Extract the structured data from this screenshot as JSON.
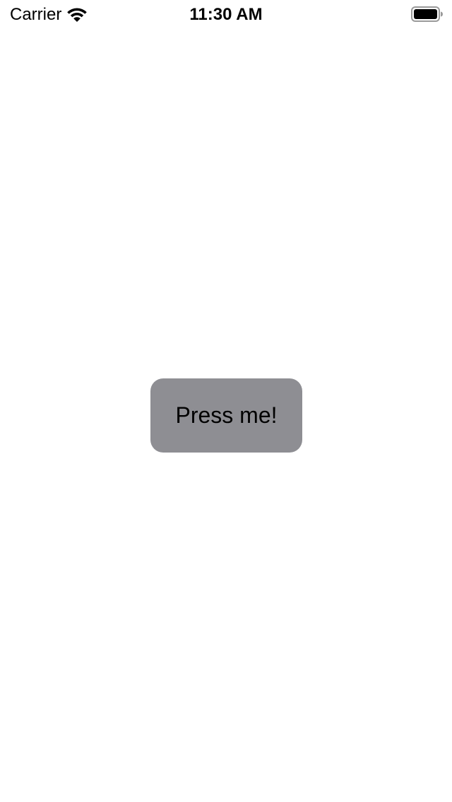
{
  "status_bar": {
    "carrier": "Carrier",
    "time": "11:30 AM",
    "wifi_icon": "wifi-icon",
    "battery_icon": "battery-full-icon"
  },
  "main": {
    "button_label": "Press me!",
    "button_color": "#8e8e93",
    "background_color": "#ffffff"
  }
}
